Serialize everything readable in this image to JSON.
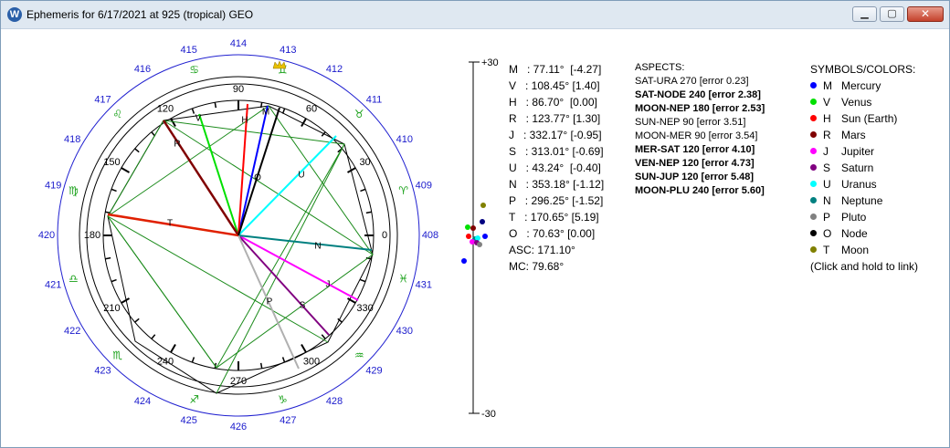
{
  "window": {
    "title": "Ephemeris for 6/17/2021 at 925 (tropical) GEO",
    "min_glyph": "▁",
    "max_glyph": "▢",
    "close_glyph": "✕"
  },
  "wheel": {
    "outer_numbers": [
      "414",
      "413",
      "412",
      "411",
      "410",
      "409",
      "408",
      "431",
      "430",
      "429",
      "428",
      "427",
      "426",
      "425",
      "424",
      "423",
      "422",
      "421",
      "420",
      "419",
      "418",
      "417",
      "416",
      "415"
    ],
    "degree_labels": [
      "90",
      "60",
      "30",
      "0",
      "330",
      "300",
      "270",
      "240",
      "210",
      "180",
      "150",
      "120"
    ],
    "zodiac_glyphs": [
      "♋",
      "♊",
      "♉",
      "♈",
      "♓",
      "♒",
      "♑",
      "♐",
      "♏",
      "♎",
      "♍",
      "♌"
    ],
    "planet_letters": {
      "M": "M",
      "V": "V",
      "H": "H",
      "R": "R",
      "J": "J",
      "S": "S",
      "U": "U",
      "N": "N",
      "P": "P",
      "T": "T",
      "O": "O"
    }
  },
  "scale": {
    "top": "+30",
    "bottom": "-30"
  },
  "readout": [
    "M   : 77.11°  [-4.27]",
    "V   : 108.45° [1.40]",
    "H   : 86.70°  [0.00]",
    "R   : 123.77° [1.30]",
    "J   : 332.17° [-0.95]",
    "S   : 313.01° [-0.69]",
    "U   : 43.24°  [-0.40]",
    "N   : 353.18° [-1.12]",
    "P   : 296.25° [-1.52]",
    "T   : 170.65° [5.19]",
    "O   : 70.63° [0.00]",
    "ASC: 171.10°",
    "MC: 79.68°"
  ],
  "aspects": {
    "header": "ASPECTS:",
    "items": [
      {
        "text": "SAT-URA 270 [error 0.23]",
        "bold": false
      },
      {
        "text": "SAT-NODE 240 [error 2.38]",
        "bold": true
      },
      {
        "text": "MOON-NEP 180 [error 2.53]",
        "bold": true
      },
      {
        "text": "SUN-NEP 90 [error 3.51]",
        "bold": false
      },
      {
        "text": "MOON-MER 90 [error 3.54]",
        "bold": false
      },
      {
        "text": "MER-SAT 120 [error 4.10]",
        "bold": true
      },
      {
        "text": "VEN-NEP 120 [error 4.73]",
        "bold": true
      },
      {
        "text": "SUN-JUP 120 [error 5.48]",
        "bold": true
      },
      {
        "text": "MOON-PLU 240 [error 5.60]",
        "bold": true
      }
    ]
  },
  "symbols": {
    "header": "SYMBOLS/COLORS:",
    "items": [
      {
        "letter": "M",
        "name": "Mercury",
        "color": "#0000ff"
      },
      {
        "letter": "V",
        "name": "Venus",
        "color": "#00e000"
      },
      {
        "letter": "H",
        "name": "Sun (Earth)",
        "color": "#ff0000"
      },
      {
        "letter": "R",
        "name": "Mars",
        "color": "#800000"
      },
      {
        "letter": "J",
        "name": "Jupiter",
        "color": "#ff00ff"
      },
      {
        "letter": "S",
        "name": "Saturn",
        "color": "#800080"
      },
      {
        "letter": "U",
        "name": "Uranus",
        "color": "#00ffff"
      },
      {
        "letter": "N",
        "name": "Neptune",
        "color": "#008080"
      },
      {
        "letter": "P",
        "name": "Pluto",
        "color": "#808080"
      },
      {
        "letter": "O",
        "name": "Node",
        "color": "#000000"
      },
      {
        "letter": "T",
        "name": "Moon",
        "color": "#808000"
      }
    ],
    "hint": "(Click and hold to link)"
  }
}
